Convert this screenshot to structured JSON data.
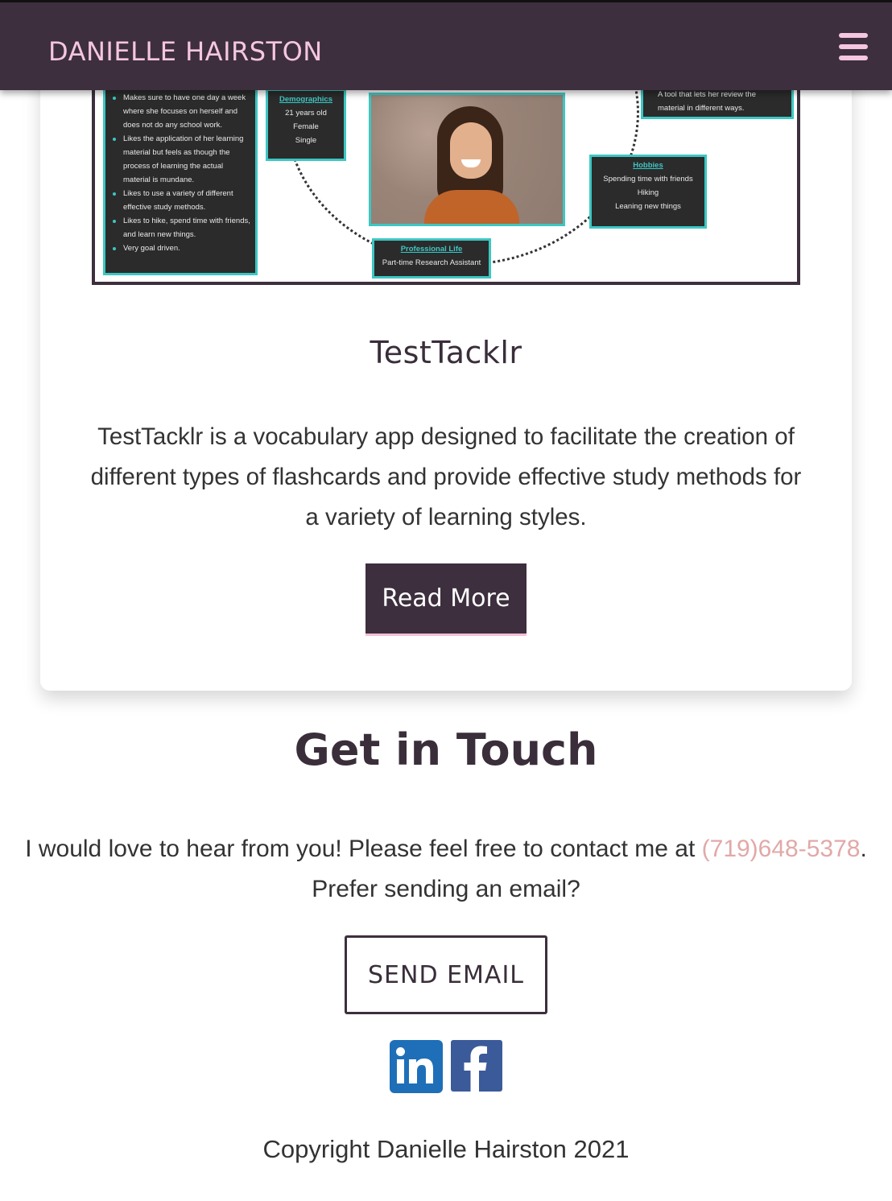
{
  "header": {
    "brand": "DANIELLE HAIRSTON",
    "menu_icon": "hamburger-menu-icon"
  },
  "project": {
    "title": "TestTacklr",
    "description": "TestTacklr is a vocabulary app designed to facilitate the creation of different types of flashcards and provide effective study methods for a variety of learning styles.",
    "read_more_label": "Read More",
    "persona": {
      "traits": [
        "Makes sure to have one day a week where she focuses on herself and does not do any school work.",
        "Likes the application of her learning material but feels as though the process of learning the actual material is mundane.",
        "Likes to use a variety of different effective study methods.",
        "Likes to hike, spend time with friends, and learn new things.",
        "Very goal driven."
      ],
      "demographics_heading": "Demographics",
      "demographics": [
        "21 years old",
        "Female",
        "Single"
      ],
      "needs_fragment": [
        "A tool that lets her review the",
        "material in different ways."
      ],
      "hobbies_heading": "Hobbies",
      "hobbies": [
        "Spending time with friends",
        "Hiking",
        "Leaning new things"
      ],
      "professional_heading": "Professional Life",
      "professional": "Part-time Research Assistant"
    }
  },
  "contact": {
    "title": "Get in Touch",
    "text_before": "I would love to hear from you! Please feel free to contact me at ",
    "phone": "(719)648-5378",
    "text_after": ". Prefer sending an email?",
    "send_email_label": "SEND EMAIL",
    "social": [
      "linkedin-icon",
      "facebook-icon"
    ]
  },
  "footer": {
    "copyright": "Copyright Danielle Hairston 2021"
  },
  "colors": {
    "primary": "#3d2f3e",
    "accent_pink": "#f5c6e0",
    "phone_link": "#e2a8a8",
    "persona_teal": "#3cc7c3",
    "linkedin": "#1e6fb8",
    "facebook": "#3b5a9a"
  }
}
